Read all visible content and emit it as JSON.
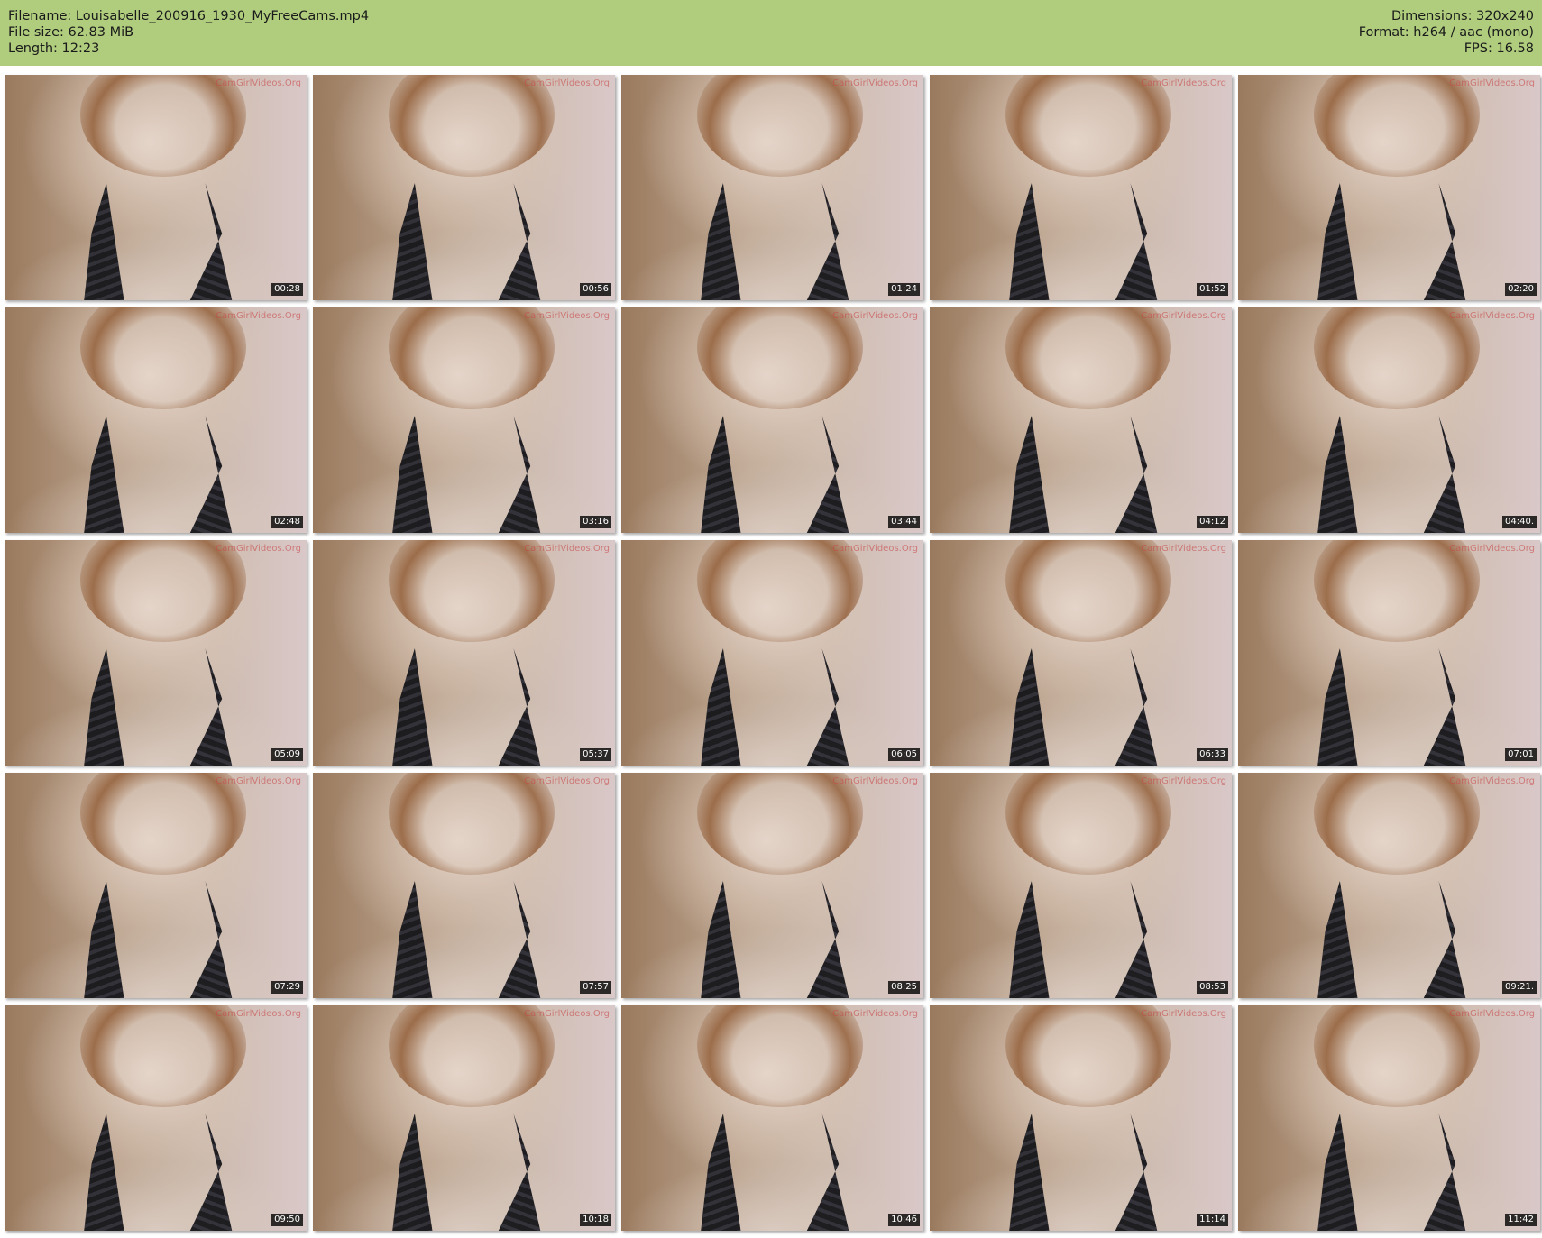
{
  "header": {
    "bg_color": "#b0cd7e",
    "left": [
      "Filename: Louisabelle_200916_1930_MyFreeCams.mp4",
      "File size: 62.83 MiB",
      "Length: 12:23"
    ],
    "right": [
      "Dimensions: 320x240",
      "Format: h264 / aac (mono)",
      "FPS: 16.58"
    ]
  },
  "watermark": "CamGirlVideos.Org",
  "thumbnails": [
    "00:28",
    "00:56",
    "01:24",
    "01:52",
    "02:20",
    "02:48",
    "03:16",
    "03:44",
    "04:12",
    "04:40.",
    "05:09",
    "05:37",
    "06:05",
    "06:33",
    "07:01",
    "07:29",
    "07:57",
    "08:25",
    "08:53",
    "09:21.",
    "09:50",
    "10:18",
    "10:46",
    "11:14",
    "11:42"
  ]
}
